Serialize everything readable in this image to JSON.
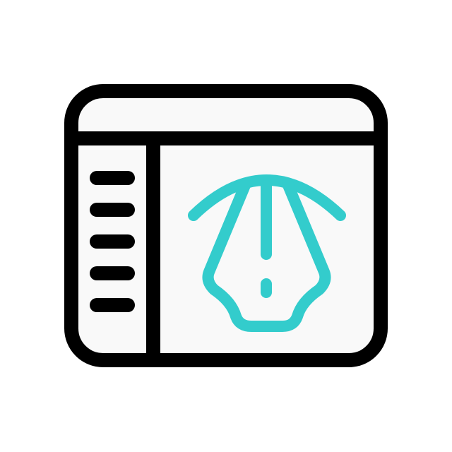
{
  "icon": {
    "name": "design-app-window-pen-tool-icon",
    "parts": [
      "app-window-icon",
      "sidebar-menu-lines-icon",
      "pen-nib-icon"
    ],
    "colors": {
      "outline": "#000000",
      "accent": "#33CCCC",
      "background": "#FFFFFF",
      "window_fill": "#F9F9F9"
    }
  }
}
